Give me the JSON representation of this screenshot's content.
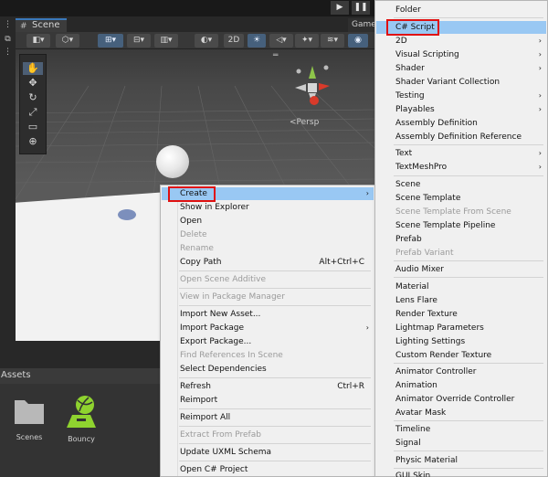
{
  "editor": {
    "scene_tab": "Scene",
    "game_tab": "Game",
    "toolbar": {
      "mode_2d": "2D"
    },
    "viewport": {
      "persp_label": "<Persp"
    },
    "assets": {
      "header": "Assets",
      "items": [
        {
          "label": "Scenes",
          "icon": "folder-icon"
        },
        {
          "label": "Bouncy",
          "icon": "physic-material-icon"
        }
      ]
    }
  },
  "context_menu": {
    "items": [
      {
        "label": "Create",
        "submenu": true,
        "highlighted": true
      },
      {
        "label": "Show in Explorer"
      },
      {
        "label": "Open"
      },
      {
        "label": "Delete",
        "disabled": true
      },
      {
        "label": "Rename",
        "disabled": true
      },
      {
        "label": "Copy Path",
        "shortcut": "Alt+Ctrl+C"
      },
      {
        "label": "Open Scene Additive",
        "disabled": true
      },
      {
        "label": "View in Package Manager",
        "disabled": true
      },
      {
        "label": "Import New Asset..."
      },
      {
        "label": "Import Package",
        "submenu": true
      },
      {
        "label": "Export Package..."
      },
      {
        "label": "Find References In Scene",
        "disabled": true
      },
      {
        "label": "Select Dependencies"
      },
      {
        "label": "Refresh",
        "shortcut": "Ctrl+R"
      },
      {
        "label": "Reimport"
      },
      {
        "label": "Reimport All"
      },
      {
        "label": "Extract From Prefab",
        "disabled": true
      },
      {
        "label": "Update UXML Schema"
      },
      {
        "label": "Open C# Project"
      }
    ]
  },
  "create_submenu": {
    "items": [
      {
        "label": "Folder"
      },
      {
        "label": "C# Script",
        "highlighted": true
      },
      {
        "label": "2D",
        "submenu": true
      },
      {
        "label": "Visual Scripting",
        "submenu": true
      },
      {
        "label": "Shader",
        "submenu": true
      },
      {
        "label": "Shader Variant Collection"
      },
      {
        "label": "Testing",
        "submenu": true
      },
      {
        "label": "Playables",
        "submenu": true
      },
      {
        "label": "Assembly Definition"
      },
      {
        "label": "Assembly Definition Reference"
      },
      {
        "label": "Text",
        "submenu": true
      },
      {
        "label": "TextMeshPro",
        "submenu": true
      },
      {
        "label": "Scene"
      },
      {
        "label": "Scene Template"
      },
      {
        "label": "Scene Template From Scene",
        "disabled": true
      },
      {
        "label": "Scene Template Pipeline"
      },
      {
        "label": "Prefab"
      },
      {
        "label": "Prefab Variant",
        "disabled": true
      },
      {
        "label": "Audio Mixer"
      },
      {
        "label": "Material"
      },
      {
        "label": "Lens Flare"
      },
      {
        "label": "Render Texture"
      },
      {
        "label": "Lightmap Parameters"
      },
      {
        "label": "Lighting Settings"
      },
      {
        "label": "Custom Render Texture"
      },
      {
        "label": "Animator Controller"
      },
      {
        "label": "Animation"
      },
      {
        "label": "Animator Override Controller"
      },
      {
        "label": "Avatar Mask"
      },
      {
        "label": "Timeline"
      },
      {
        "label": "Signal"
      },
      {
        "label": "Physic Material"
      },
      {
        "label": "GUI Skin"
      }
    ]
  },
  "colors": {
    "highlight": "#99c8f3",
    "callout": "#e01010",
    "disabled_text": "#9a9a9a"
  }
}
